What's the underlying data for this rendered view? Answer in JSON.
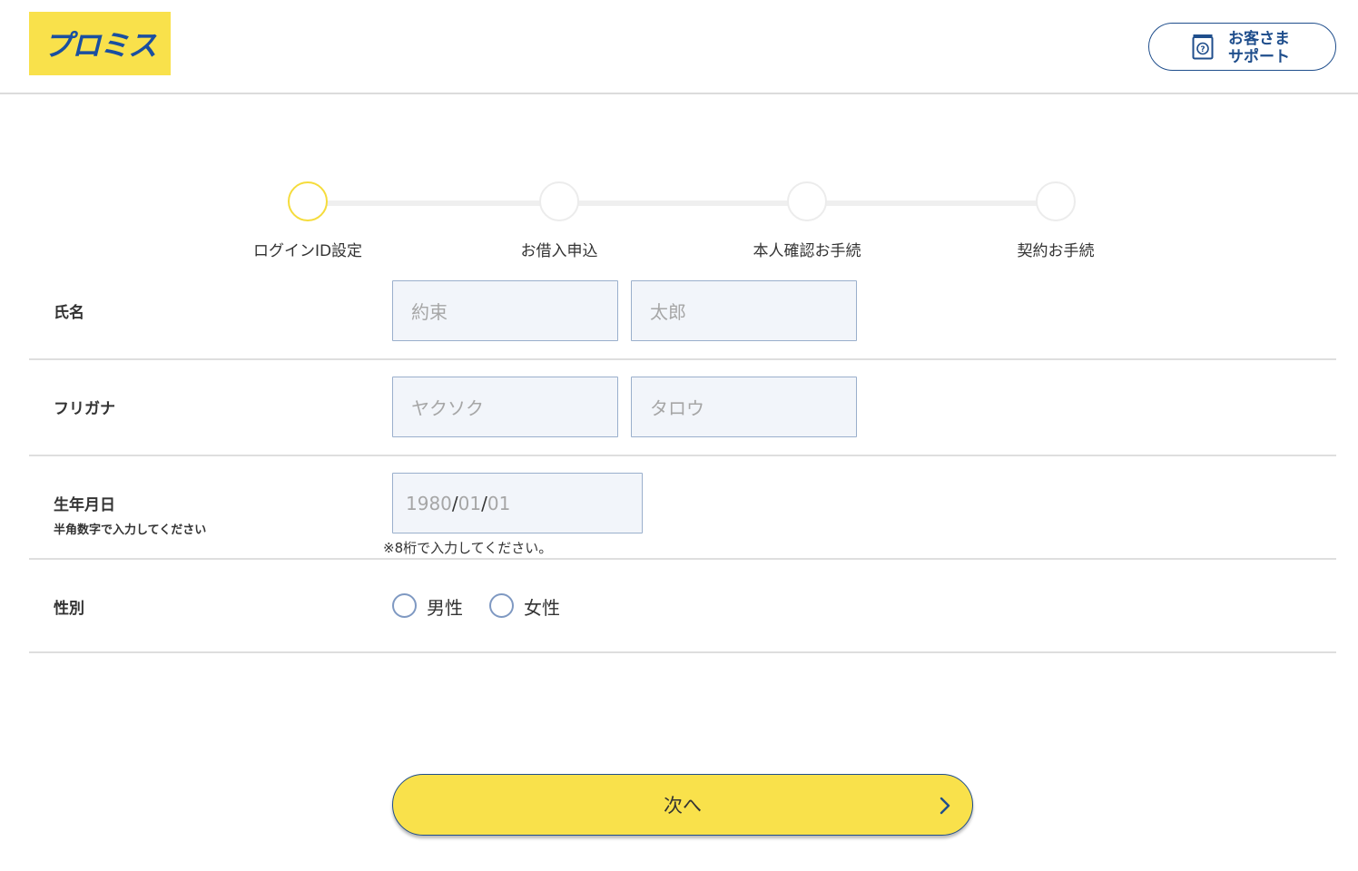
{
  "header": {
    "logo_text": "プロミス",
    "support_label_line1": "お客さま",
    "support_label_line2": "サポート",
    "support_icon": "help-document-icon"
  },
  "stepper": {
    "steps": [
      {
        "label": "ログインID設定",
        "active": true
      },
      {
        "label": "お借入申込",
        "active": false
      },
      {
        "label": "本人確認お手続",
        "active": false
      },
      {
        "label": "契約お手続",
        "active": false
      }
    ]
  },
  "form": {
    "name": {
      "label": "氏名",
      "last_placeholder": "約束",
      "first_placeholder": "太郎"
    },
    "kana": {
      "label": "フリガナ",
      "last_placeholder": "ヤクソク",
      "first_placeholder": "タロウ"
    },
    "birthdate": {
      "label": "生年月日",
      "sublabel": "半角数字で入力してください",
      "year_placeholder": "1980",
      "separator": "/",
      "month_placeholder": "01",
      "day_placeholder": "01",
      "hint": "※8桁で入力してください。"
    },
    "gender": {
      "label": "性別",
      "options": [
        "男性",
        "女性"
      ]
    }
  },
  "next_button": {
    "label": "次へ"
  },
  "colors": {
    "brand_yellow": "#f9e14b",
    "brand_blue": "#1f4e8c",
    "field_bg": "#f2f5fa",
    "field_border": "#9aafcc"
  }
}
